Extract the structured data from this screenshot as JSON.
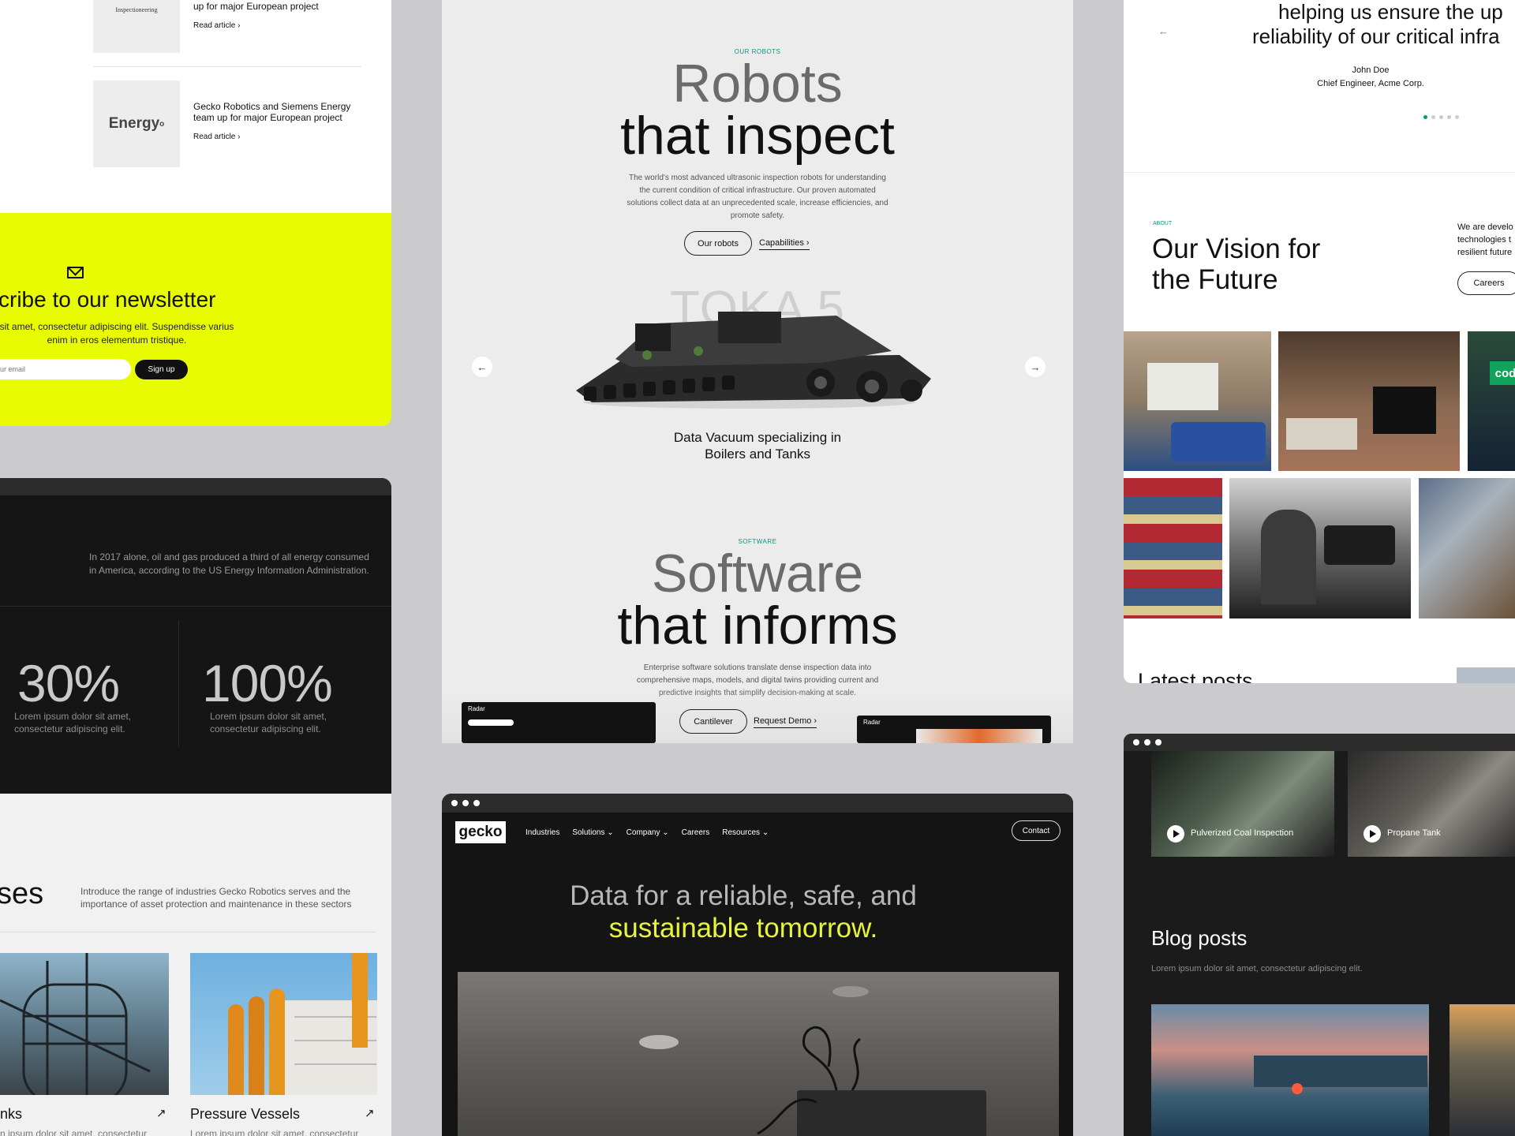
{
  "articles": {
    "items": [
      {
        "logo": "Inspectioneering",
        "title": "up for major European project",
        "link": "Read article ›"
      },
      {
        "logo": "Energy",
        "title": "Gecko Robotics and Siemens Energy team up for major European project",
        "link": "Read article ›"
      }
    ]
  },
  "newsletter": {
    "title": "cribe to our newsletter",
    "body": "sit amet, consectetur adipiscing elit. Suspendisse varius enim in eros elementum tristique.",
    "email_placeholder": "ur email",
    "signup_label": "Sign up"
  },
  "stats": {
    "intro": "In 2017 alone, oil and gas produced a third of all energy consumed in America, according to the US Energy Information Administration.",
    "items": [
      {
        "value": "30%",
        "caption": "Lorem ipsum dolor sit amet, consectetur adipiscing elit."
      },
      {
        "value": "100%",
        "caption": "Lorem ipsum dolor sit amet, consectetur adipiscing elit."
      }
    ]
  },
  "industries": {
    "heading": "ses",
    "intro": "Introduce the range of industries Gecko Robotics serves and the importance of asset protection and maintenance in these sectors",
    "cards": [
      {
        "title": "nks",
        "body": "n ipsum dolor sit amet, consectetur"
      },
      {
        "title": "Pressure Vessels",
        "body": "Lorem ipsum dolor sit amet, consectetur"
      }
    ]
  },
  "robots": {
    "eyebrow": "OUR ROBOTS",
    "title_light": "Robots",
    "title_dark": "that inspect",
    "body": "The world's most advanced ultrasonic inspection robots for understanding the current condition of critical infrastructure. Our proven automated solutions collect data at an unprecedented scale, increase efficiencies, and promote safety.",
    "btn_primary": "Our robots",
    "btn_link": "Capabilities ›",
    "product_name": "TOKA 5",
    "caption": "Data Vacuum specializing in Boilers and Tanks",
    "prev_icon": "←",
    "next_icon": "→"
  },
  "software": {
    "eyebrow": "SOFTWARE",
    "title_light": "Software",
    "title_dark": "that informs",
    "body": "Enterprise software solutions translate dense inspection data into comprehensive maps, models, and digital twins providing current and predictive insights that simplify decision-making at scale.",
    "btn_primary": "Cantilever",
    "btn_link": "Request Demo ›",
    "shot_label": "Radar"
  },
  "gecko": {
    "logo": "gecko",
    "nav": [
      "Industries",
      "Solutions",
      "Company",
      "Careers",
      "Resources"
    ],
    "contact": "Contact",
    "hero_light": "Data for a reliable, safe, and",
    "hero_accent": "sustainable tomorrow.",
    "accent_color": "#e6f53a"
  },
  "vision": {
    "quote_line1": "helping us ensure the up",
    "quote_line2": "reliability of our critical infra",
    "author": "John Doe",
    "role": "Chief Engineer, Acme Corp.",
    "eyebrow": "ABOUT",
    "title_line1": "Our Vision for",
    "title_line2": "the Future",
    "side_text": "We are develo technologies t resilient future",
    "careers": "Careers",
    "latest": "Latest posts",
    "badge": "cod"
  },
  "blog": {
    "videos": [
      "Pulverized Coal Inspection",
      "Propane Tank"
    ],
    "title": "Blog posts",
    "subtitle": "Lorem ipsum dolor sit amet, consectetur adipiscing elit."
  }
}
